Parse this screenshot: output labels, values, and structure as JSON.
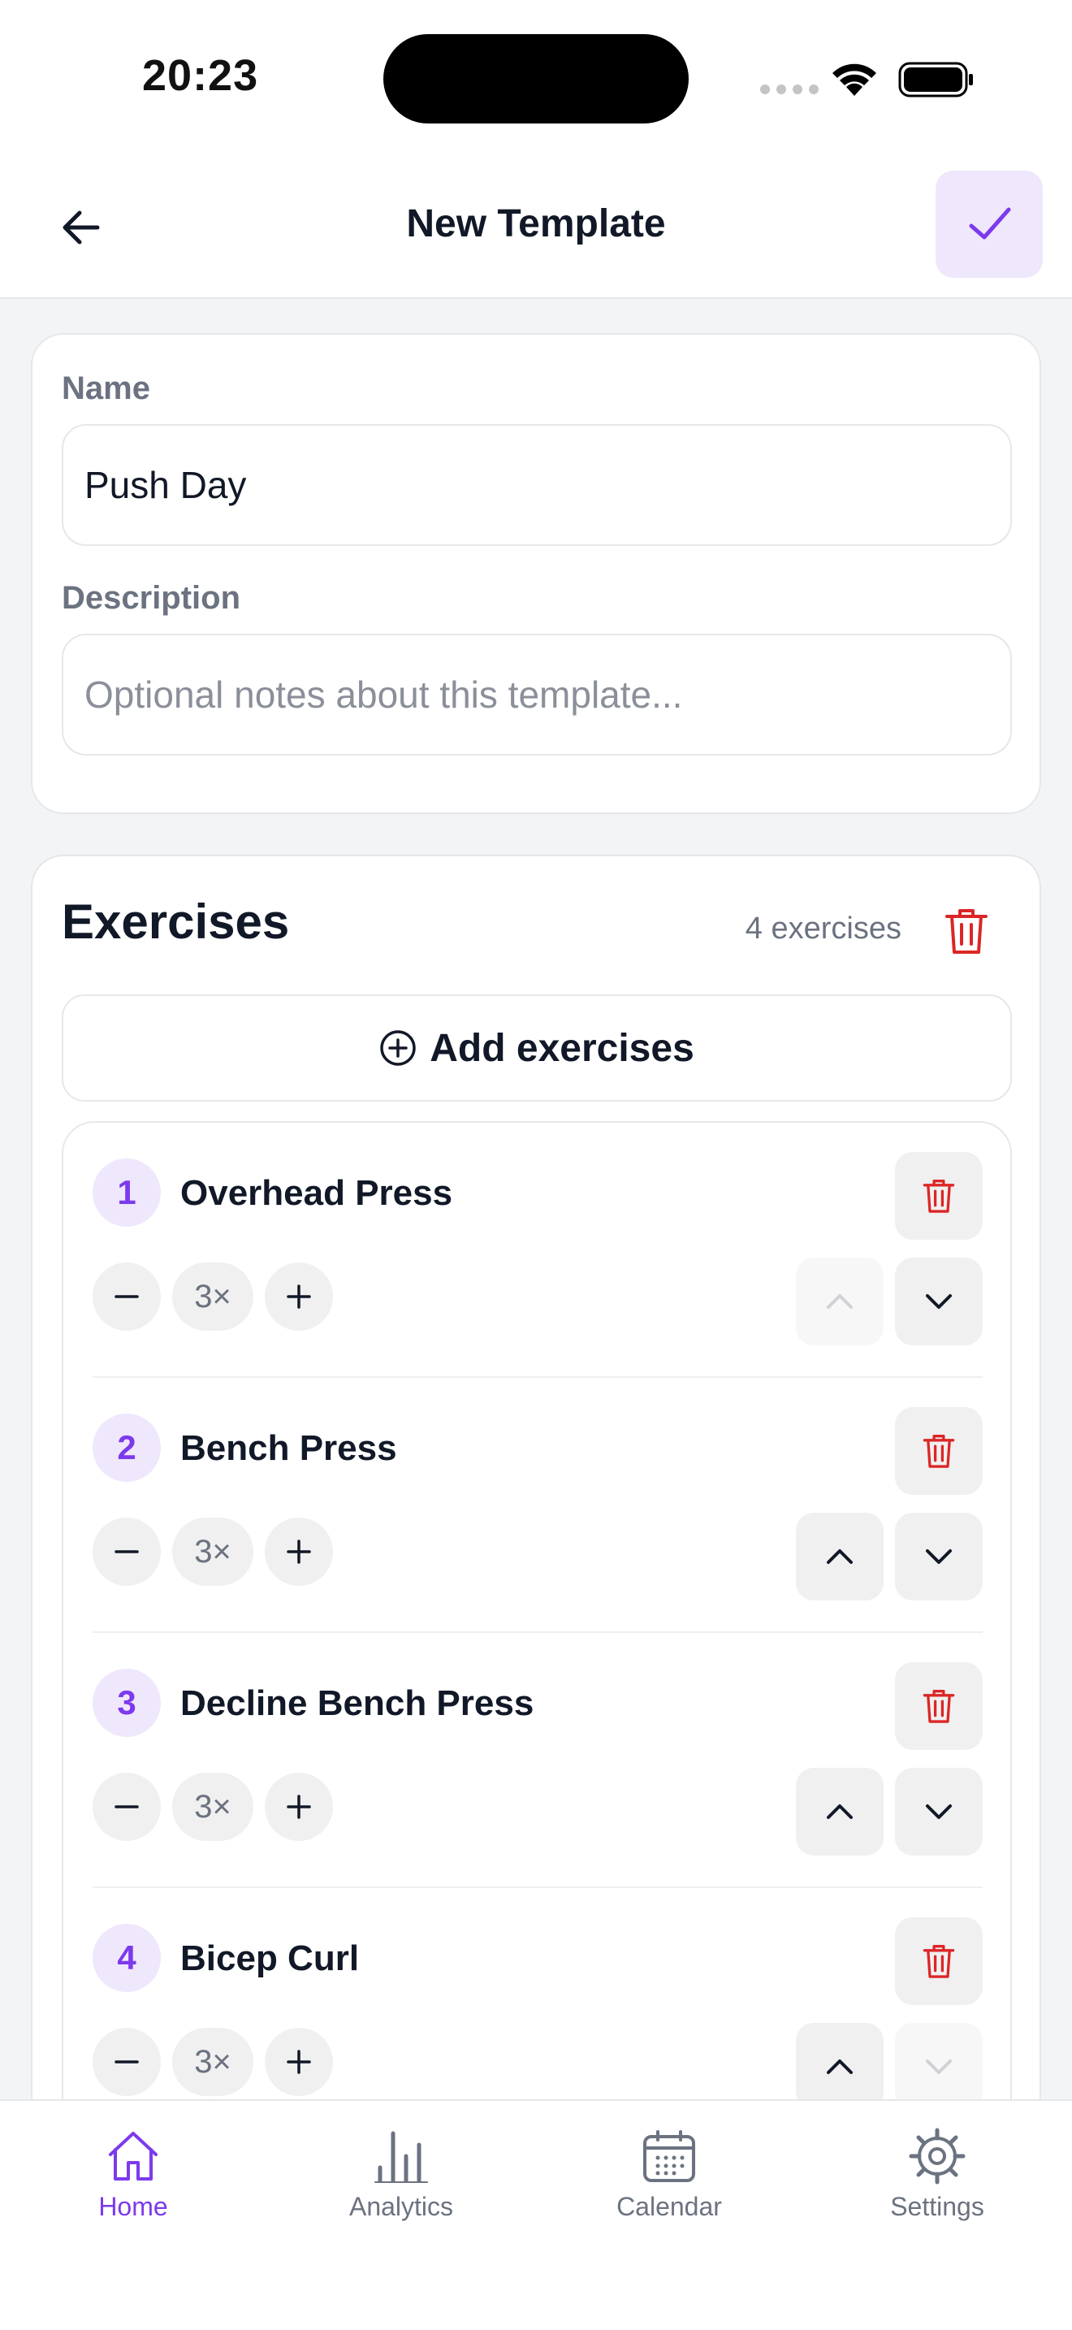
{
  "status_bar": {
    "time": "20:23"
  },
  "header": {
    "title": "New Template"
  },
  "form": {
    "name_label": "Name",
    "name_value": "Push Day",
    "description_label": "Description",
    "description_placeholder": "Optional notes about this template..."
  },
  "exercises": {
    "title": "Exercises",
    "count": "4 exercises",
    "add_label": "Add exercises",
    "items": [
      {
        "index": "1",
        "name": "Overhead Press",
        "sets": "3×",
        "can_move_up": false,
        "can_move_down": true
      },
      {
        "index": "2",
        "name": "Bench Press",
        "sets": "3×",
        "can_move_up": true,
        "can_move_down": true
      },
      {
        "index": "3",
        "name": "Decline Bench Press",
        "sets": "3×",
        "can_move_up": true,
        "can_move_down": true
      },
      {
        "index": "4",
        "name": "Bicep Curl",
        "sets": "3×",
        "can_move_up": true,
        "can_move_down": false
      }
    ]
  },
  "tabs": [
    {
      "label": "Home",
      "icon": "home-icon",
      "active": true
    },
    {
      "label": "Analytics",
      "icon": "bar-chart-icon",
      "active": false
    },
    {
      "label": "Calendar",
      "icon": "calendar-icon",
      "active": false
    },
    {
      "label": "Settings",
      "icon": "gear-icon",
      "active": false
    }
  ],
  "colors": {
    "accent": "#7c3aed",
    "danger": "#dc2626",
    "accent_bg": "#efe7fc"
  }
}
